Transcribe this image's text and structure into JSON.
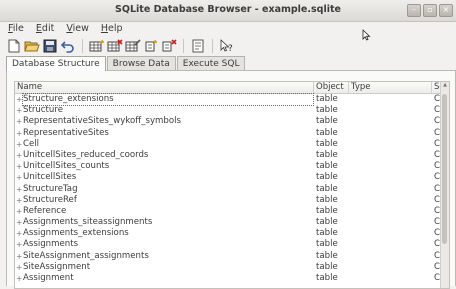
{
  "window": {
    "title": "SQLite Database Browser - example.sqlite"
  },
  "menu": [
    {
      "label": "File"
    },
    {
      "label": "Edit"
    },
    {
      "label": "View"
    },
    {
      "label": "Help"
    }
  ],
  "toolbar": {
    "icons": [
      "new-database-icon",
      "open-database-icon",
      "save-icon",
      "undo-icon",
      "create-table-icon",
      "delete-table-icon",
      "modify-table-icon",
      "create-index-icon",
      "delete-index-icon",
      "sql-icon",
      "whats-this-icon"
    ]
  },
  "tabs": [
    {
      "label": "Database Structure",
      "active": true
    },
    {
      "label": "Browse Data",
      "active": false
    },
    {
      "label": "Execute SQL",
      "active": false
    }
  ],
  "tree": {
    "columns": [
      "Name",
      "Object",
      "Type",
      "Sc"
    ],
    "rows": [
      {
        "name": "Structure_extensions",
        "object": "table",
        "schema": "C..."
      },
      {
        "name": "Structure",
        "object": "table",
        "schema": "C..."
      },
      {
        "name": "RepresentativeSites_wykoff_symbols",
        "object": "table",
        "schema": "C..."
      },
      {
        "name": "RepresentativeSites",
        "object": "table",
        "schema": "C..."
      },
      {
        "name": "Cell",
        "object": "table",
        "schema": "C..."
      },
      {
        "name": "UnitcellSites_reduced_coords",
        "object": "table",
        "schema": "C..."
      },
      {
        "name": "UnitcellSites_counts",
        "object": "table",
        "schema": "C..."
      },
      {
        "name": "UnitcellSites",
        "object": "table",
        "schema": "C..."
      },
      {
        "name": "StructureTag",
        "object": "table",
        "schema": "C..."
      },
      {
        "name": "StructureRef",
        "object": "table",
        "schema": "C..."
      },
      {
        "name": "Reference",
        "object": "table",
        "schema": "C..."
      },
      {
        "name": "Assignments_siteassignments",
        "object": "table",
        "schema": "C..."
      },
      {
        "name": "Assignments_extensions",
        "object": "table",
        "schema": "C..."
      },
      {
        "name": "Assignments",
        "object": "table",
        "schema": "C..."
      },
      {
        "name": "SiteAssignment_assignments",
        "object": "table",
        "schema": "C..."
      },
      {
        "name": "SiteAssignment",
        "object": "table",
        "schema": "C..."
      },
      {
        "name": "Assignment",
        "object": "table",
        "schema": "C..."
      }
    ]
  }
}
